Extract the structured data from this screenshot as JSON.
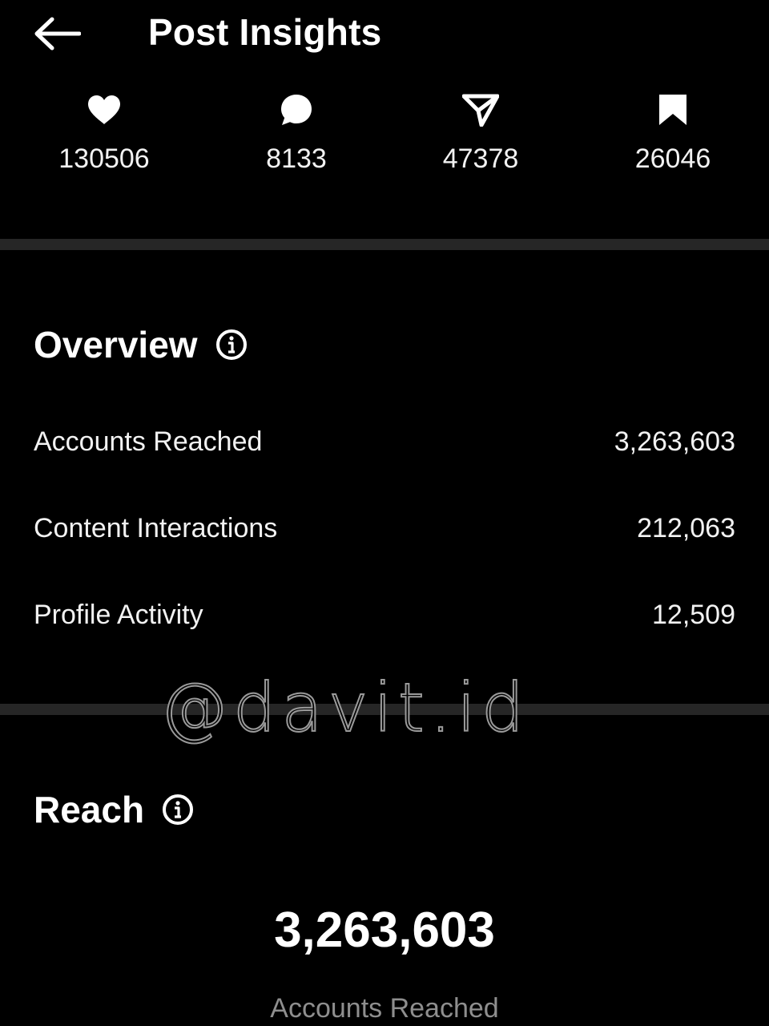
{
  "header": {
    "title": "Post Insights",
    "back_icon": "arrow-left-icon"
  },
  "stats": [
    {
      "icon": "heart-icon",
      "value": "130506"
    },
    {
      "icon": "comment-icon",
      "value": "8133"
    },
    {
      "icon": "share-icon",
      "value": "47378"
    },
    {
      "icon": "bookmark-icon",
      "value": "26046"
    }
  ],
  "overview": {
    "title": "Overview",
    "info_icon": "info-icon",
    "rows": [
      {
        "label": "Accounts Reached",
        "value": "3,263,603"
      },
      {
        "label": "Content Interactions",
        "value": "212,063"
      },
      {
        "label": "Profile Activity",
        "value": "12,509"
      }
    ]
  },
  "watermark": "@davit.id",
  "reach": {
    "title": "Reach",
    "info_icon": "info-icon",
    "value": "3,263,603",
    "caption": "Accounts Reached"
  },
  "colors": {
    "background": "#000000",
    "text": "#ffffff",
    "divider": "#262626",
    "caption": "#8e8e8e"
  }
}
